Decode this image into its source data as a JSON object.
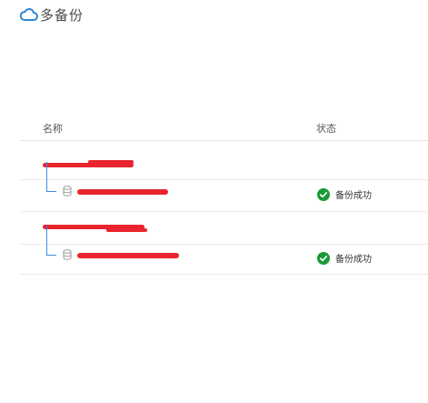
{
  "app": {
    "logo_text": "多备份"
  },
  "table": {
    "col_name": "名称",
    "col_status": "状态"
  },
  "groups": [
    {
      "items": [
        {
          "status": "备份成功",
          "status_color": "#1a9a35"
        }
      ]
    },
    {
      "items": [
        {
          "status": "备份成功",
          "status_color": "#1a9a35"
        }
      ]
    }
  ],
  "icons": {
    "logo": "cloud-icon",
    "database": "database-icon",
    "success": "check-circle-icon",
    "tree": "tree-connector"
  }
}
